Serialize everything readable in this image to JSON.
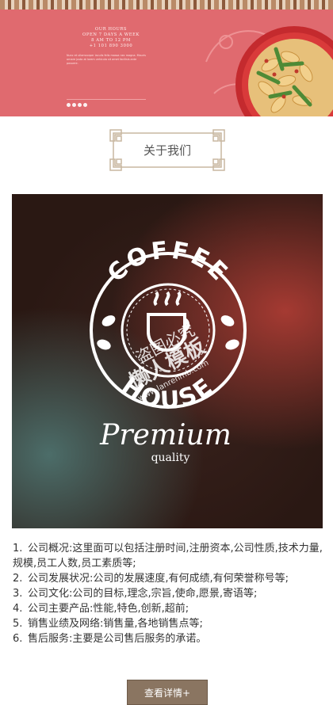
{
  "banner": {
    "hours_lines": [
      "OUR HOURS",
      "OPEN 7 DAYS A WEEK",
      "8 AM TO 12 PM",
      "+1 101 890 3000"
    ],
    "blurb": "Nunc et ullamcorper iaculis felis massa nec magna. Mauris ornare justo at lorem vehicula sit amet facilisis ante posuere.",
    "carousel_dot_count": 4,
    "background_color": "#e06a6f"
  },
  "section": {
    "title": "关于我们"
  },
  "hero": {
    "logo_top": "COFFEE",
    "logo_bottom": "HOUSE",
    "script_text": "Premium",
    "subtext": "quality",
    "watermark_line1": "盗图必究",
    "watermark_line2": "懒人模板",
    "watermark_url": "www.lanrenmb.com"
  },
  "about": {
    "items": [
      {
        "num": "1.",
        "text": "公司概况:这里面可以包括注册时间,注册资本,公司性质,技术力量,规模,员工人数,员工素质等;"
      },
      {
        "num": "2.",
        "text": "公司发展状况:公司的发展速度,有何成绩,有何荣誉称号等;"
      },
      {
        "num": "3.",
        "text": "公司文化:公司的目标,理念,宗旨,使命,愿景,寄语等;"
      },
      {
        "num": "4.",
        "text": "公司主要产品:性能,特色,创新,超前;"
      },
      {
        "num": "5.",
        "text": "销售业绩及网络:销售量,各地销售点等;"
      },
      {
        "num": "6.",
        "text": "售后服务:主要是公司售后服务的承诺。"
      }
    ]
  },
  "more_button": {
    "label": "查看详情+"
  }
}
